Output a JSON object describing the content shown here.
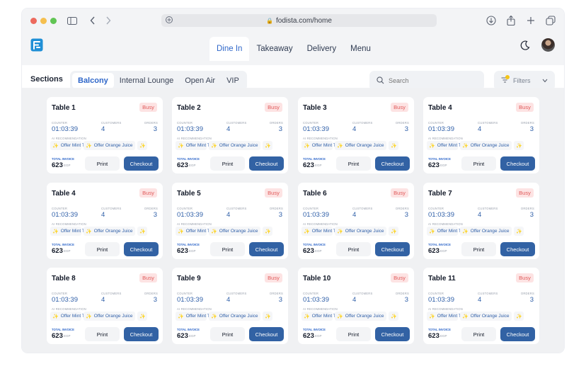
{
  "browser": {
    "url": "fodista.com/home"
  },
  "nav": {
    "tabs": [
      "Dine In",
      "Takeaway",
      "Delivery",
      "Menu"
    ],
    "active_tab": "Dine In"
  },
  "sections": {
    "label": "Sections",
    "items": [
      "Balcony",
      "Internal Lounge",
      "Open Air",
      "VIP"
    ],
    "active": "Balcony"
  },
  "search": {
    "placeholder": "Search"
  },
  "filters": {
    "label": "Filters"
  },
  "card_labels": {
    "counter": "COUNTER",
    "customers": "CUSTOMERS",
    "orders": "ORDERS",
    "ai_recommendation": "AI RECOMMENDATION",
    "total_invoice": "TOTAL INVOICE",
    "currency": "EGP",
    "print": "Print",
    "checkout": "Checkout"
  },
  "tables": [
    {
      "name": "Table 1",
      "status": "Busy",
      "counter": "01:03:39",
      "customers": "4",
      "orders": "3",
      "recommendations": [
        "Offer Mint Tea",
        "Offer Orange Juice",
        ""
      ],
      "total": "623"
    },
    {
      "name": "Table 2",
      "status": "Busy",
      "counter": "01:03:39",
      "customers": "4",
      "orders": "3",
      "recommendations": [
        "Offer Mint Tea",
        "Offer Orange Juice",
        ""
      ],
      "total": "623"
    },
    {
      "name": "Table 3",
      "status": "Busy",
      "counter": "01:03:39",
      "customers": "4",
      "orders": "3",
      "recommendations": [
        "Offer Mint Tea",
        "Offer Orange Juice",
        ""
      ],
      "total": "623"
    },
    {
      "name": "Table 4",
      "status": "Busy",
      "counter": "01:03:39",
      "customers": "4",
      "orders": "3",
      "recommendations": [
        "Offer Mint Tea",
        "Offer Orange Juice",
        ""
      ],
      "total": "623"
    },
    {
      "name": "Table 4",
      "status": "Busy",
      "counter": "01:03:39",
      "customers": "4",
      "orders": "3",
      "recommendations": [
        "Offer Mint Tea",
        "Offer Orange Juice",
        ""
      ],
      "total": "623"
    },
    {
      "name": "Table 5",
      "status": "Busy",
      "counter": "01:03:39",
      "customers": "4",
      "orders": "3",
      "recommendations": [
        "Offer Mint Tea",
        "Offer Orange Juice",
        ""
      ],
      "total": "623"
    },
    {
      "name": "Table 6",
      "status": "Busy",
      "counter": "01:03:39",
      "customers": "4",
      "orders": "3",
      "recommendations": [
        "Offer Mint Tea",
        "Offer Orange Juice",
        ""
      ],
      "total": "623"
    },
    {
      "name": "Table 7",
      "status": "Busy",
      "counter": "01:03:39",
      "customers": "4",
      "orders": "3",
      "recommendations": [
        "Offer Mint Tea",
        "Offer Orange Juice",
        ""
      ],
      "total": "623"
    },
    {
      "name": "Table 8",
      "status": "Busy",
      "counter": "01:03:39",
      "customers": "4",
      "orders": "3",
      "recommendations": [
        "Offer Mint Tea",
        "Offer Orange Juice",
        ""
      ],
      "total": "623"
    },
    {
      "name": "Table 9",
      "status": "Busy",
      "counter": "01:03:39",
      "customers": "4",
      "orders": "3",
      "recommendations": [
        "Offer Mint Tea",
        "Offer Orange Juice",
        ""
      ],
      "total": "623"
    },
    {
      "name": "Table 10",
      "status": "Busy",
      "counter": "01:03:39",
      "customers": "4",
      "orders": "3",
      "recommendations": [
        "Offer Mint Tea",
        "Offer Orange Juice",
        ""
      ],
      "total": "623"
    },
    {
      "name": "Table 11",
      "status": "Busy",
      "counter": "01:03:39",
      "customers": "4",
      "orders": "3",
      "recommendations": [
        "Offer Mint Tea",
        "Offer Orange Juice",
        ""
      ],
      "total": "623"
    }
  ],
  "colors": {
    "accent": "#2f67c9",
    "checkout": "#3262a4",
    "busy_bg": "#fde3e3",
    "busy_text": "#e05a5a",
    "spark": "#f2b81c"
  }
}
